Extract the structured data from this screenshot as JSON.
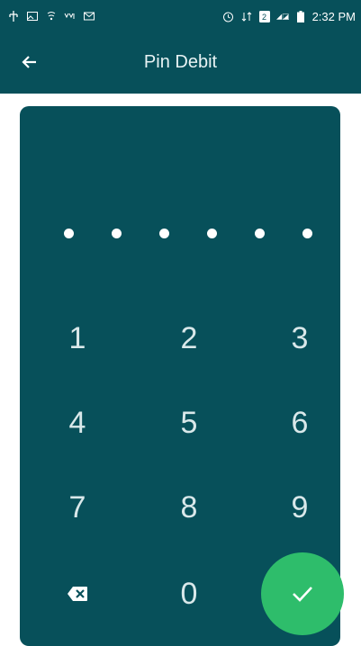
{
  "status_bar": {
    "time": "2:32 PM",
    "icons": [
      "usb-icon",
      "image-icon",
      "wifi-call-icon",
      "yupp-icon",
      "mail-icon",
      "alarm-icon",
      "data-icon",
      "sim2-icon",
      "signal-icon",
      "battery-icon"
    ]
  },
  "app_bar": {
    "title": "Pin Debit",
    "back_icon": "arrow-left-icon"
  },
  "pin": {
    "digits_entered": 6
  },
  "keypad": {
    "keys": [
      "1",
      "2",
      "3",
      "4",
      "5",
      "6",
      "7",
      "8",
      "9",
      "0"
    ],
    "backspace_icon": "backspace-icon",
    "confirm_icon": "check-icon",
    "confirm_color": "#2ebd6b"
  },
  "colors": {
    "primary": "#07505a",
    "accent": "#2ebd6b",
    "text": "#ffffff"
  }
}
